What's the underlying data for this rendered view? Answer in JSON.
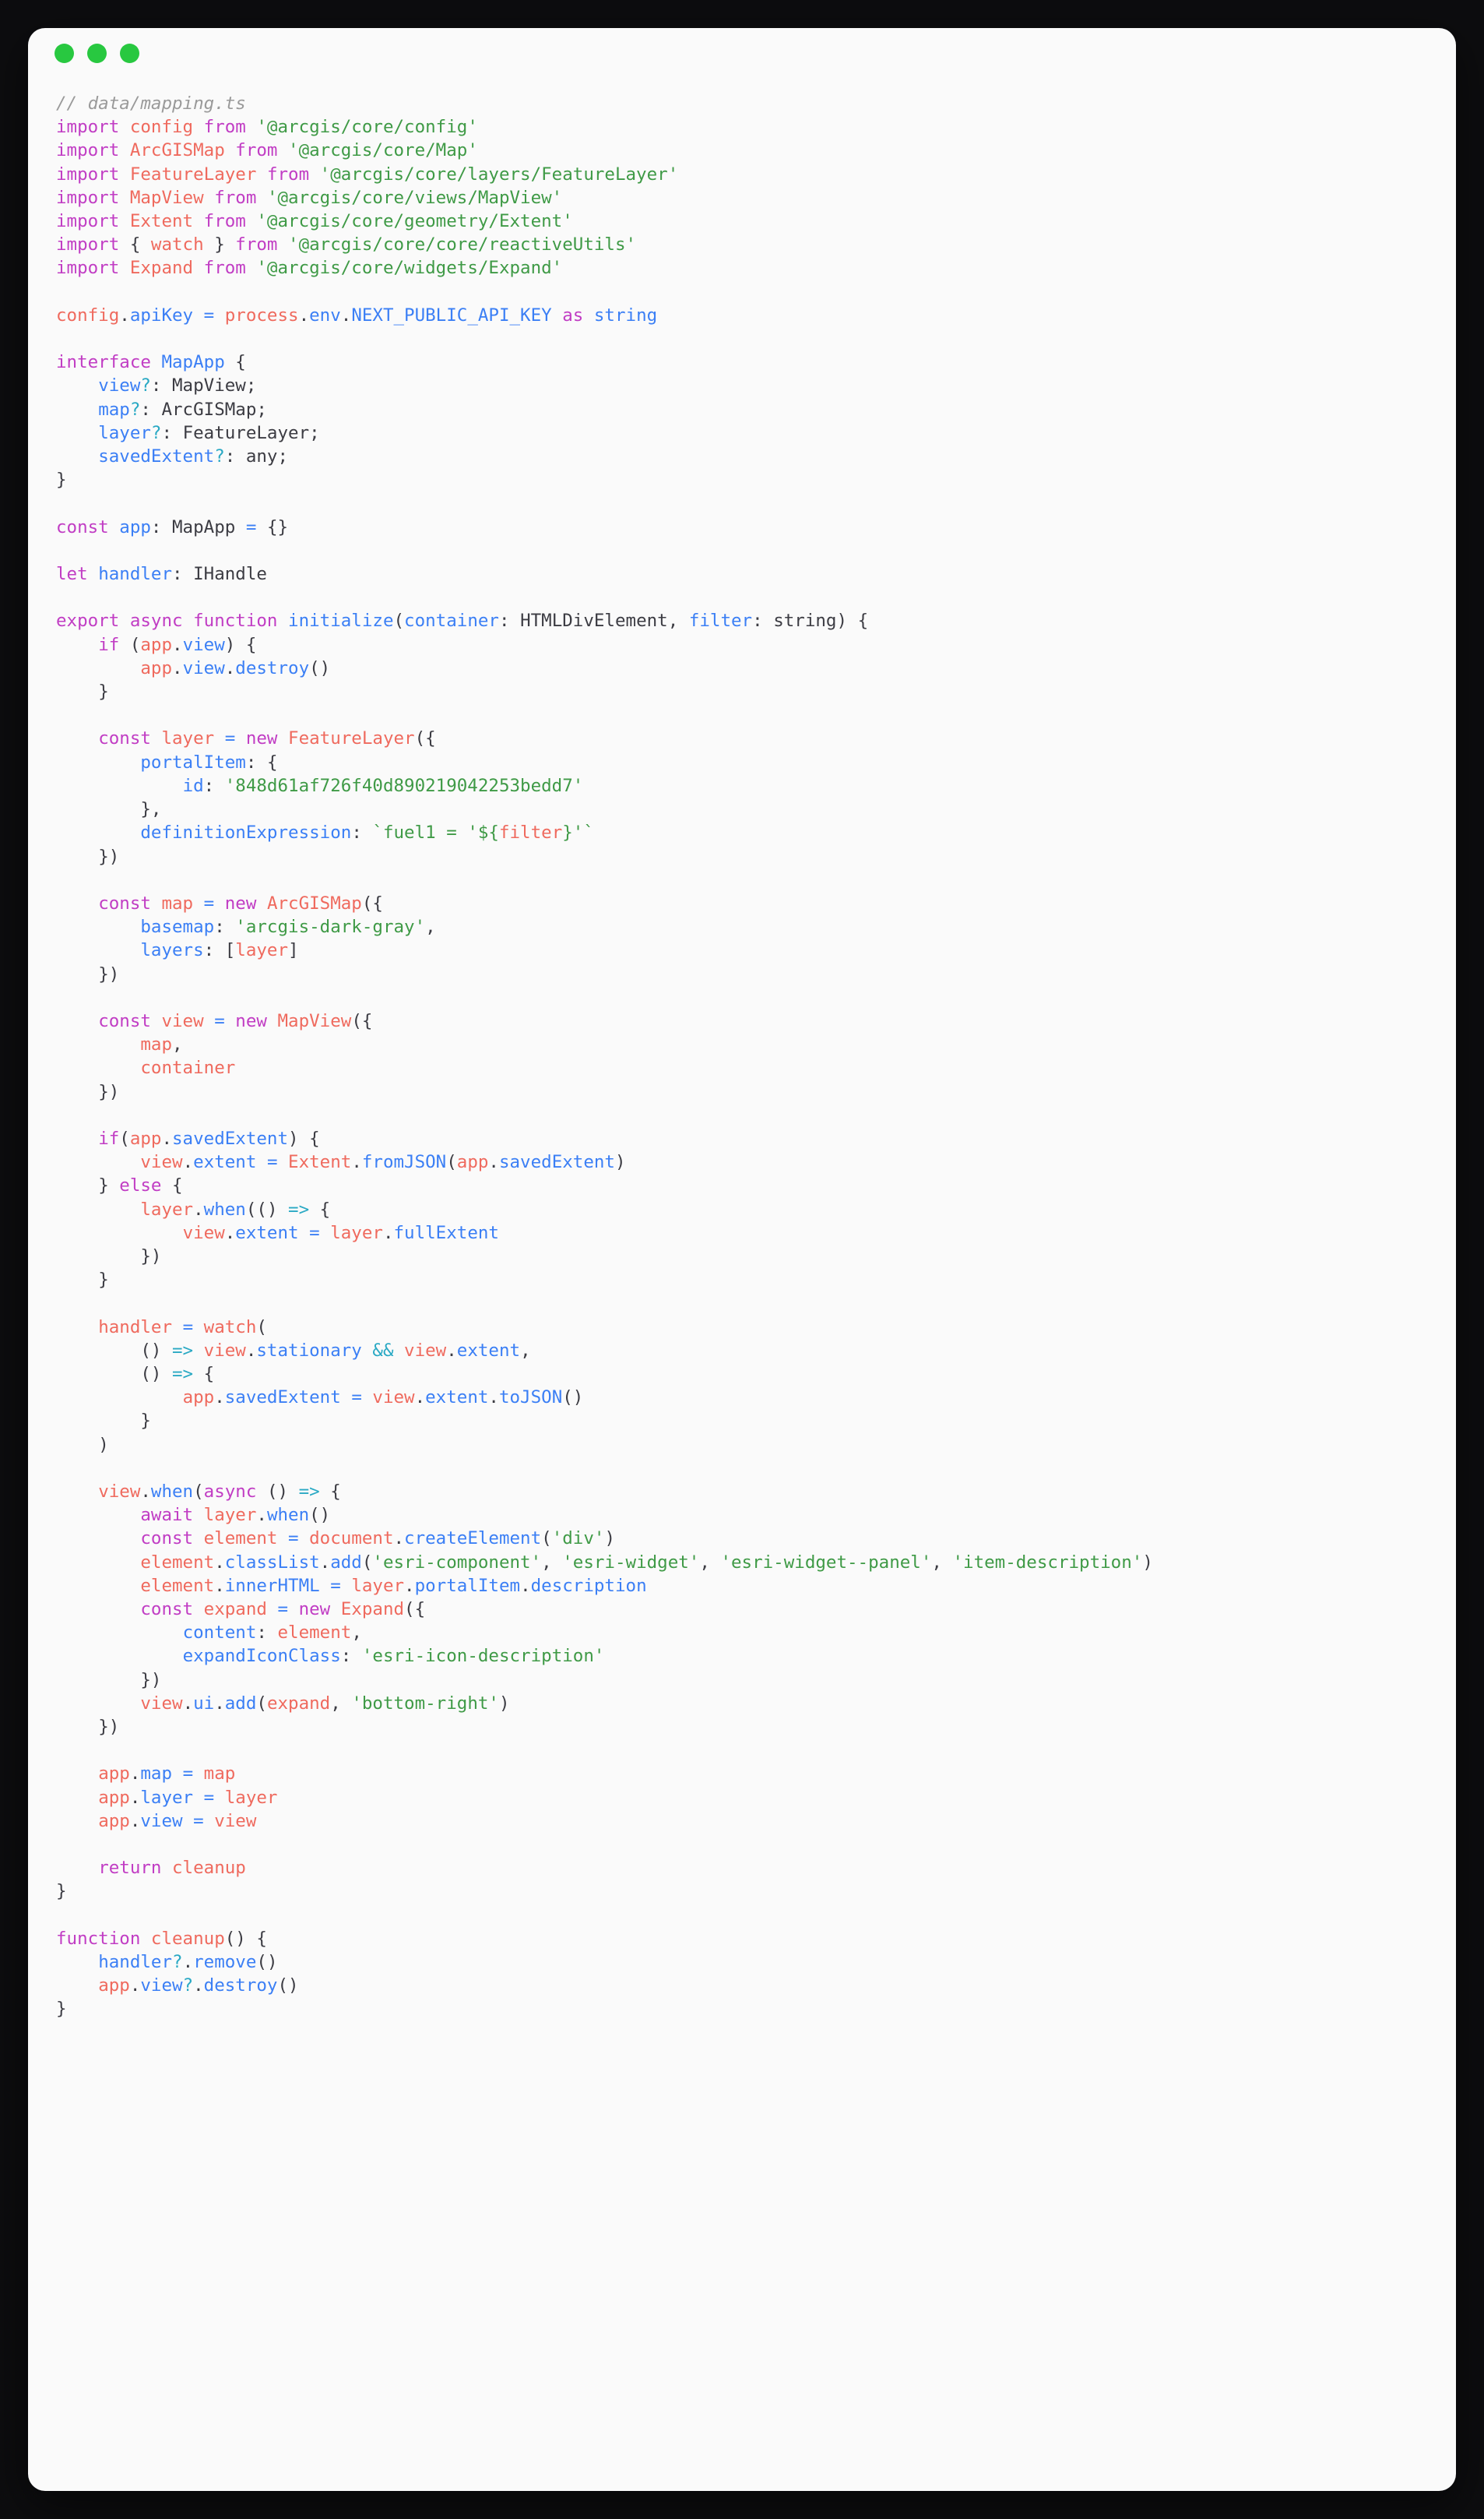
{
  "window": {
    "traffic_lights": [
      {
        "name": "close",
        "color": "#ff5f57"
      },
      {
        "name": "minimize",
        "color": "#febc2e"
      },
      {
        "name": "maximize",
        "color": "#28c840"
      }
    ],
    "background": "#fafafa",
    "page_background": "#0d0d0f"
  },
  "theme": {
    "comment": "#9a9a9a",
    "keyword": "#c13dc4",
    "identifier": "#3b7ff5",
    "string": "#3f9a46",
    "object": "#ef6a5e",
    "operator_cyan": "#2aa9c4",
    "text": "#3c3c43"
  },
  "code": {
    "language": "typescript",
    "filename_comment": "// data/mapping.ts",
    "lines": [
      "// data/mapping.ts",
      "import config from '@arcgis/core/config'",
      "import ArcGISMap from '@arcgis/core/Map'",
      "import FeatureLayer from '@arcgis/core/layers/FeatureLayer'",
      "import MapView from '@arcgis/core/views/MapView'",
      "import Extent from '@arcgis/core/geometry/Extent'",
      "import { watch } from '@arcgis/core/core/reactiveUtils'",
      "import Expand from '@arcgis/core/widgets/Expand'",
      "",
      "config.apiKey = process.env.NEXT_PUBLIC_API_KEY as string",
      "",
      "interface MapApp {",
      "    view?: MapView;",
      "    map?: ArcGISMap;",
      "    layer?: FeatureLayer;",
      "    savedExtent?: any;",
      "}",
      "",
      "const app: MapApp = {}",
      "",
      "let handler: IHandle",
      "",
      "export async function initialize(container: HTMLDivElement, filter: string) {",
      "    if (app.view) {",
      "        app.view.destroy()",
      "    }",
      "",
      "    const layer = new FeatureLayer({",
      "        portalItem: {",
      "            id: '848d61af726f40d890219042253bedd7'",
      "        },",
      "        definitionExpression: `fuel1 = '${filter}'`",
      "    })",
      "",
      "    const map = new ArcGISMap({",
      "        basemap: 'arcgis-dark-gray',",
      "        layers: [layer]",
      "    })",
      "",
      "    const view = new MapView({",
      "        map,",
      "        container",
      "    })",
      "",
      "    if(app.savedExtent) {",
      "        view.extent = Extent.fromJSON(app.savedExtent)",
      "    } else {",
      "        layer.when(() => {",
      "            view.extent = layer.fullExtent",
      "        })",
      "    }",
      "",
      "    handler = watch(",
      "        () => view.stationary && view.extent,",
      "        () => {",
      "            app.savedExtent = view.extent.toJSON()",
      "        }",
      "    )",
      "",
      "    view.when(async () => {",
      "        await layer.when()",
      "        const element = document.createElement('div')",
      "        element.classList.add('esri-component', 'esri-widget', 'esri-widget--panel', 'item-description')",
      "        element.innerHTML = layer.portalItem.description",
      "        const expand = new Expand({",
      "            content: element,",
      "            expandIconClass: 'esri-icon-description'",
      "        })",
      "        view.ui.add(expand, 'bottom-right')",
      "    })",
      "",
      "    app.map = map",
      "    app.layer = layer",
      "    app.view = view",
      "",
      "    return cleanup",
      "}",
      "",
      "function cleanup() {",
      "    handler?.remove()",
      "    app.view?.destroy()",
      "}"
    ]
  }
}
